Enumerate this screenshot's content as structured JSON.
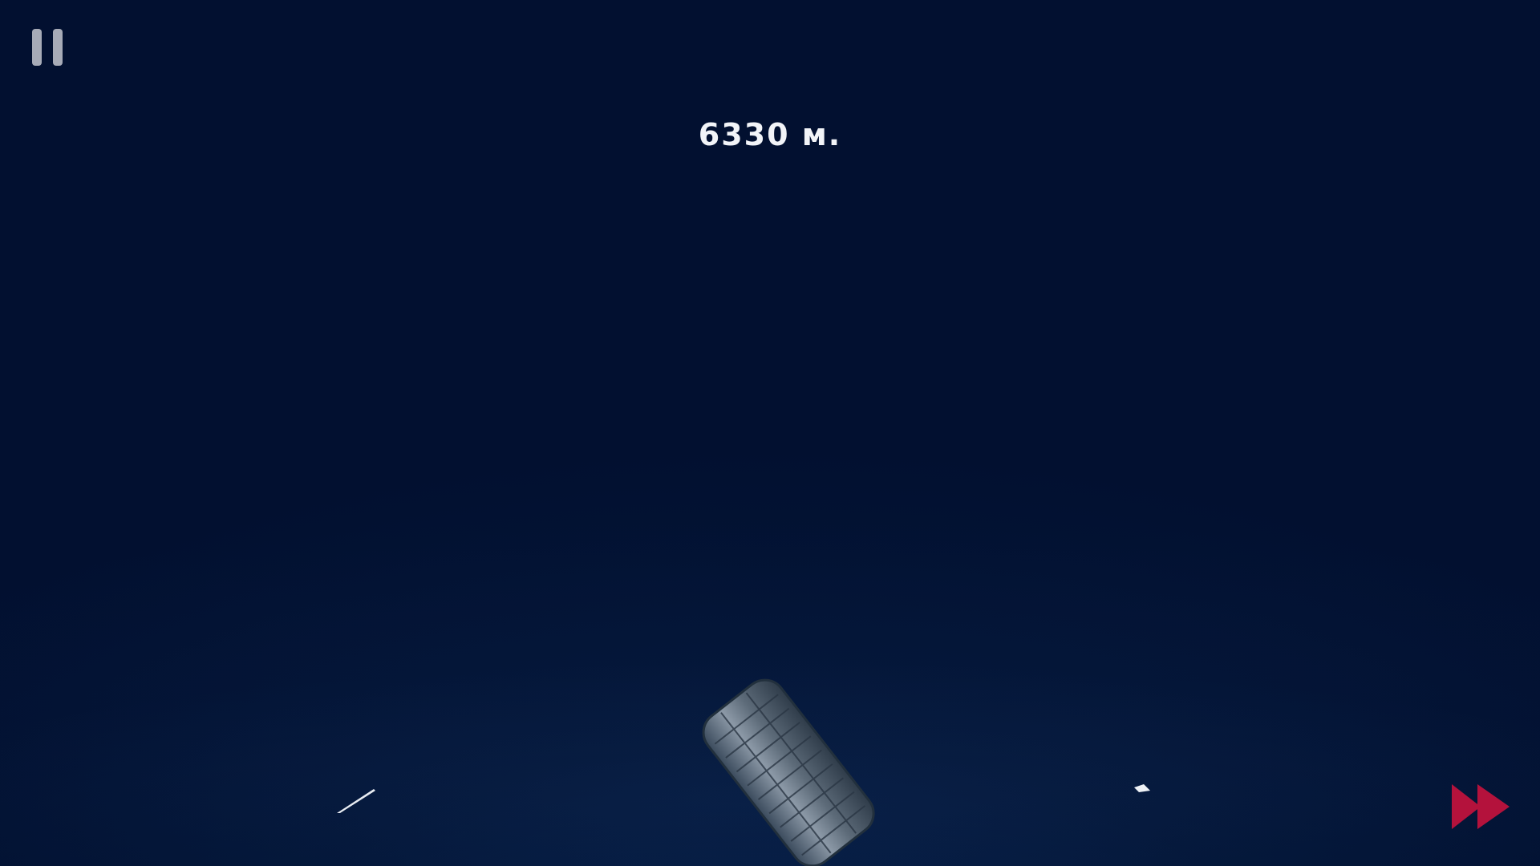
{
  "hud": {
    "distance_text": "6330 м.",
    "pause_icon": "pause-icon",
    "fast_forward_icon": "fast-forward-icon"
  },
  "colors": {
    "background": "#021030",
    "hud_text": "#f2f4f8",
    "pause_icon": "#b9bcc6",
    "fast_forward": "#b4123c"
  },
  "scene": {
    "objects": [
      "tire",
      "debris",
      "debris"
    ]
  }
}
